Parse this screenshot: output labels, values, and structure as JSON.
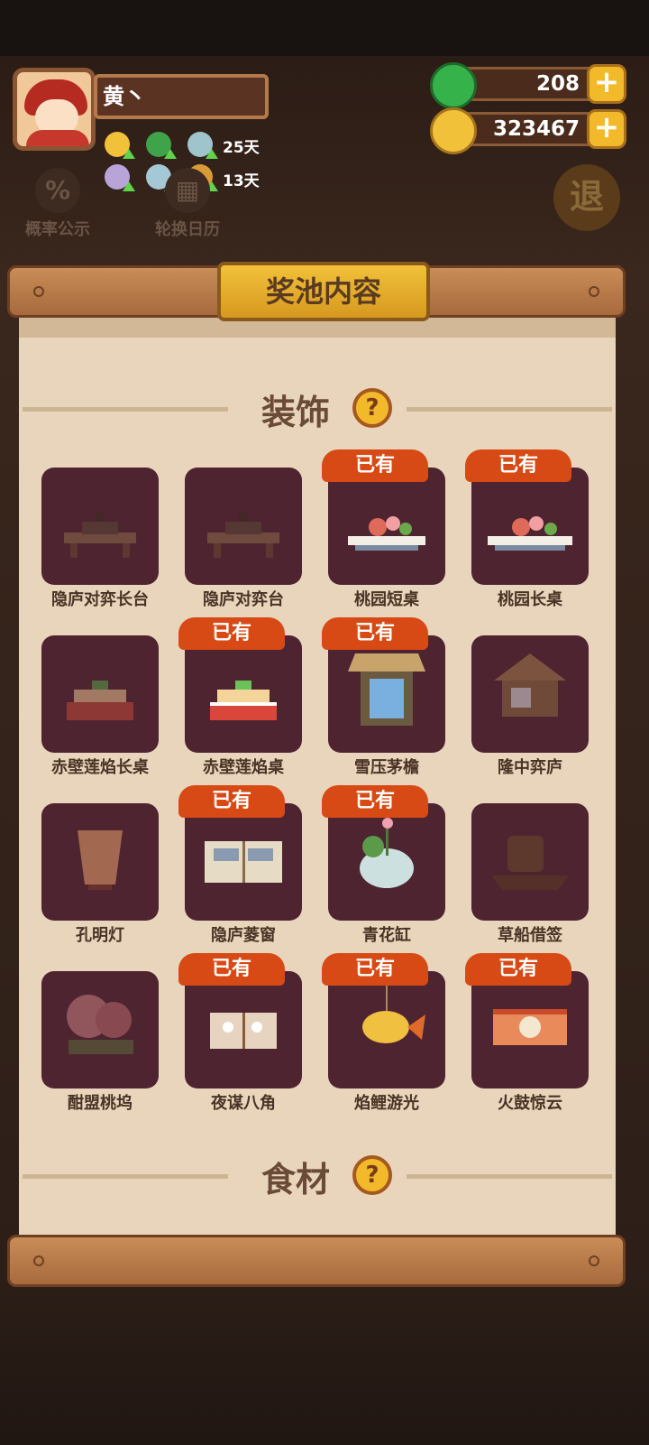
{
  "player": {
    "name": "黄丶",
    "buffs_row1_days": "25天",
    "buffs_row2_days": "13天"
  },
  "currency": {
    "jade": "208",
    "coins": "323467"
  },
  "side_buttons": {
    "probability": "概率公示",
    "rotation_calendar": "轮换日历",
    "exit": "退"
  },
  "dialog": {
    "title": "奖池内容",
    "sections": [
      {
        "label": "装饰",
        "help": "?"
      },
      {
        "label": "食材",
        "help": "?"
      }
    ],
    "owned_label": "已有",
    "items": [
      {
        "name": "隐庐对弈长台",
        "owned": false
      },
      {
        "name": "隐庐对弈台",
        "owned": false
      },
      {
        "name": "桃园短桌",
        "owned": true
      },
      {
        "name": "桃园长桌",
        "owned": true
      },
      {
        "name": "赤壁莲焰长桌",
        "owned": false
      },
      {
        "name": "赤壁莲焰桌",
        "owned": true
      },
      {
        "name": "雪压茅檐",
        "owned": true
      },
      {
        "name": "隆中弈庐",
        "owned": false
      },
      {
        "name": "孔明灯",
        "owned": false
      },
      {
        "name": "隐庐菱窗",
        "owned": true
      },
      {
        "name": "青花缸",
        "owned": true
      },
      {
        "name": "草船借签",
        "owned": false
      },
      {
        "name": "酣盟桃坞",
        "owned": false
      },
      {
        "name": "夜谋八角",
        "owned": true
      },
      {
        "name": "焰鲤游光",
        "owned": true
      },
      {
        "name": "火鼓惊云",
        "owned": true
      }
    ]
  },
  "colors": {
    "card": "#4e2431",
    "owned_badge": "#d74a16",
    "panel": "#e8d5bb",
    "gold": "#f2b92b"
  }
}
